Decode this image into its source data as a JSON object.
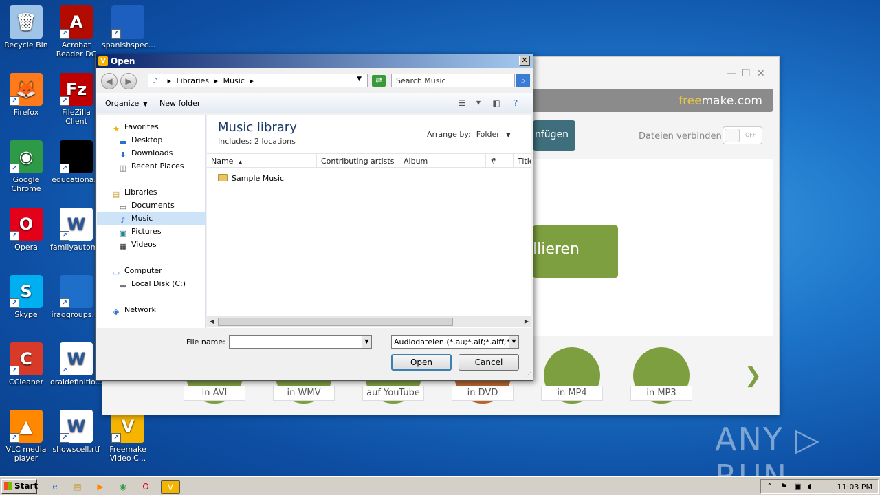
{
  "desktop": {
    "icons": [
      {
        "label": "Recycle Bin",
        "icon": "recycle-bin-icon",
        "color": "#9fc4e6",
        "glyph": "🗑"
      },
      {
        "label": "Acrobat Reader DC",
        "icon": "acrobat-icon",
        "color": "#b30b00",
        "glyph": "A"
      },
      {
        "label": "spanishspec...",
        "icon": "file-icon",
        "color": "#1d5fbf",
        "glyph": ""
      },
      {
        "label": "Firefox",
        "icon": "firefox-icon",
        "color": "#ff7a1a",
        "glyph": "🦊"
      },
      {
        "label": "FileZilla Client",
        "icon": "filezilla-icon",
        "color": "#bf0000",
        "glyph": "Fz"
      },
      {
        "label": "Google Chrome",
        "icon": "chrome-icon",
        "color": "#2e9a48",
        "glyph": "◉"
      },
      {
        "label": "educationa...",
        "icon": "file-icon",
        "color": "#000000",
        "glyph": ""
      },
      {
        "label": "Opera",
        "icon": "opera-icon",
        "color": "#e3001b",
        "glyph": "O"
      },
      {
        "label": "familyautom...",
        "icon": "word-doc-icon",
        "color": "#ffffff",
        "glyph": "W"
      },
      {
        "label": "Skype",
        "icon": "skype-icon",
        "color": "#00aff0",
        "glyph": "S"
      },
      {
        "label": "iraqgroups....",
        "icon": "file-icon",
        "color": "#1d6fc9",
        "glyph": ""
      },
      {
        "label": "CCleaner",
        "icon": "ccleaner-icon",
        "color": "#d83a2a",
        "glyph": "C"
      },
      {
        "label": "oraldefinitio...",
        "icon": "word-doc-icon",
        "color": "#ffffff",
        "glyph": "W"
      },
      {
        "label": "VLC media player",
        "icon": "vlc-icon",
        "color": "#ff8800",
        "glyph": "▲"
      },
      {
        "label": "showscell.rtf",
        "icon": "word-doc-icon",
        "color": "#ffffff",
        "glyph": "W"
      },
      {
        "label": "Freemake Video C...",
        "icon": "freemake-icon",
        "color": "#f5b400",
        "glyph": "V"
      }
    ],
    "watermark": "ANY ▷ RUN"
  },
  "freemake": {
    "logo_prefix": "free",
    "logo_suffix": "make.com",
    "join_button": "nfügen",
    "join_files_label": "Dateien verbinden",
    "toggle_state": "OFF",
    "big_button": "llieren",
    "outputs": [
      {
        "label": "in AVI",
        "color": "#7e9f3f"
      },
      {
        "label": "in WMV",
        "color": "#7e9f3f"
      },
      {
        "label": "auf YouTube",
        "color": "#7e9f3f"
      },
      {
        "label": "in DVD",
        "color": "#b5652d"
      },
      {
        "label": "in MP4",
        "color": "#7e9f3f"
      },
      {
        "label": "in MP3",
        "color": "#7e9f3f"
      }
    ],
    "next_glyph": "❯"
  },
  "dialog": {
    "title": "Open",
    "close_glyph": "✕",
    "breadcrumb": [
      "Libraries",
      "Music"
    ],
    "search_placeholder": "Search Music",
    "toolbar": {
      "organize": "Organize",
      "new_folder": "New folder"
    },
    "nav": [
      {
        "label": "Favorites",
        "icon": "star-icon",
        "glyph": "★",
        "color": "#e8b400",
        "indent": 0
      },
      {
        "label": "Desktop",
        "icon": "desktop-icon",
        "glyph": "▬",
        "color": "#2a6fc9",
        "indent": 1
      },
      {
        "label": "Downloads",
        "icon": "downloads-icon",
        "glyph": "⬇",
        "color": "#2a6fc9",
        "indent": 1
      },
      {
        "label": "Recent Places",
        "icon": "recent-places-icon",
        "glyph": "◫",
        "color": "#555555",
        "indent": 1
      },
      {
        "label": "Libraries",
        "icon": "libraries-icon",
        "glyph": "▤",
        "color": "#c49a2a",
        "indent": 0
      },
      {
        "label": "Documents",
        "icon": "documents-icon",
        "glyph": "▭",
        "color": "#666666",
        "indent": 1
      },
      {
        "label": "Music",
        "icon": "music-icon",
        "glyph": "♪",
        "color": "#2a6fc9",
        "indent": 1,
        "selected": true
      },
      {
        "label": "Pictures",
        "icon": "pictures-icon",
        "glyph": "▣",
        "color": "#2a7a9a",
        "indent": 1
      },
      {
        "label": "Videos",
        "icon": "videos-icon",
        "glyph": "▦",
        "color": "#333333",
        "indent": 1
      },
      {
        "label": "Computer",
        "icon": "computer-icon",
        "glyph": "▭",
        "color": "#2a6fc9",
        "indent": 0
      },
      {
        "label": "Local Disk (C:)",
        "icon": "disk-icon",
        "glyph": "▬",
        "color": "#777777",
        "indent": 1
      },
      {
        "label": "Network",
        "icon": "network-icon",
        "glyph": "◈",
        "color": "#2a6fc9",
        "indent": 0
      }
    ],
    "library_title": "Music library",
    "library_subtitle": "Includes:  2 locations",
    "arrange_label": "Arrange by:",
    "arrange_value": "Folder",
    "columns": [
      "Name",
      "Contributing artists",
      "Album",
      "#",
      "Title"
    ],
    "files": [
      {
        "name": "Sample Music",
        "type": "folder"
      }
    ],
    "file_name_label": "File name:",
    "file_name_value": "",
    "file_type": "Audiodateien (*.au;*.aif;*.aiff;*.a",
    "open_button": "Open",
    "cancel_button": "Cancel"
  },
  "taskbar": {
    "start_label": "Start",
    "apps": [
      {
        "name": "ie-icon",
        "glyph": "e",
        "color": "#1e73d6"
      },
      {
        "name": "explorer-icon",
        "glyph": "▤",
        "color": "#c49a2a"
      },
      {
        "name": "media-player-icon",
        "glyph": "▶",
        "color": "#ff8800"
      },
      {
        "name": "chrome-icon",
        "glyph": "◉",
        "color": "#2e9a48"
      },
      {
        "name": "opera-icon",
        "glyph": "O",
        "color": "#e3001b"
      }
    ],
    "active_app_glyph": "V",
    "clock": "11:03 PM"
  }
}
